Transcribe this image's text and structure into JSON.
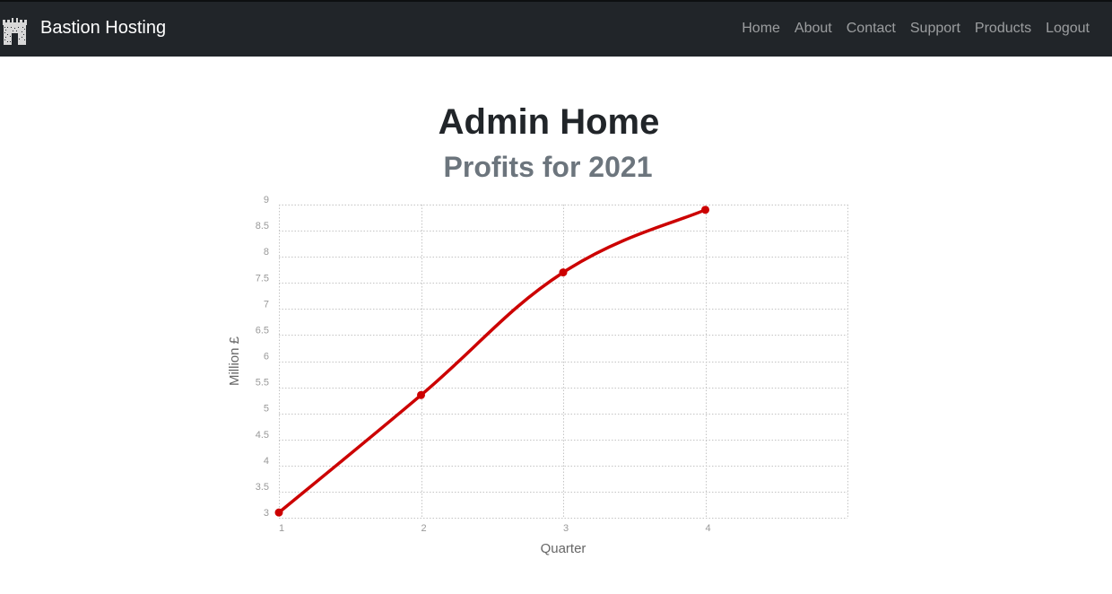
{
  "navbar": {
    "brand": "Bastion Hosting",
    "logo_icon": "castle-icon",
    "links": [
      "Home",
      "About",
      "Contact",
      "Support",
      "Products",
      "Logout"
    ]
  },
  "page": {
    "title": "Admin Home",
    "subtitle": "Profits for 2021"
  },
  "colors": {
    "navbar_bg": "#212529",
    "series_line": "#cc0000",
    "title_text": "#212529",
    "subtitle_text": "#6c757d"
  },
  "chart_data": {
    "type": "line",
    "xlabel": "Quarter",
    "ylabel": "Million £",
    "x": [
      1,
      2,
      3,
      4
    ],
    "x_ticks": [
      "1",
      "2",
      "3",
      "4"
    ],
    "y_ticks": [
      "3",
      "3.5",
      "4",
      "4.5",
      "5",
      "5.5",
      "6",
      "6.5",
      "7",
      "7.5",
      "8",
      "8.5",
      "9"
    ],
    "xlim": [
      1,
      5
    ],
    "ylim": [
      3,
      9
    ],
    "series": [
      {
        "values": [
          3.1,
          5.35,
          7.7,
          8.9
        ],
        "color": "#cc0000",
        "smooth": true
      }
    ],
    "grid": true,
    "legend": false
  }
}
